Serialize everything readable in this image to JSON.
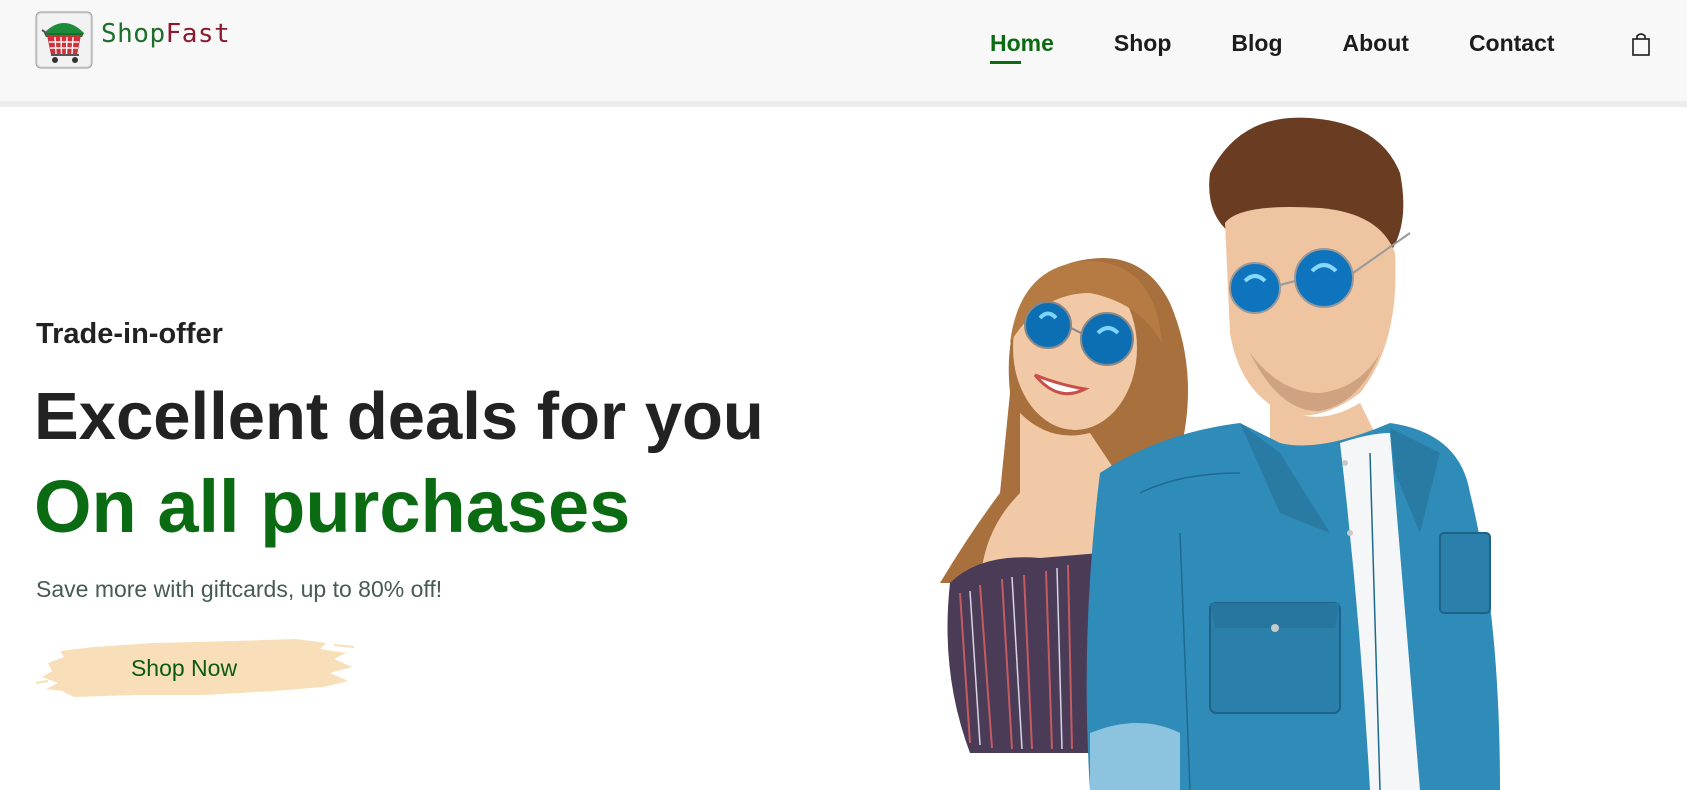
{
  "brand": {
    "part1": "Shop",
    "part2": "Fast"
  },
  "nav": {
    "items": [
      {
        "label": "Home",
        "active": true
      },
      {
        "label": "Shop",
        "active": false
      },
      {
        "label": "Blog",
        "active": false
      },
      {
        "label": "About",
        "active": false
      },
      {
        "label": "Contact",
        "active": false
      }
    ],
    "cart_icon": "shopping-bag-icon"
  },
  "hero": {
    "eyebrow": "Trade-in-offer",
    "headline": "Excellent deals for you",
    "headline_accent": "On all purchases",
    "subtext": "Save more with giftcards, up to 80% off!",
    "cta_label": "Shop Now",
    "image": "couple-in-sunglasses"
  },
  "colors": {
    "accent": "#0b6b12",
    "brand_shop": "#1d6f2a",
    "brand_fast": "#8b1a2f",
    "header_bg": "#f8f8f8",
    "cta_bg": "#f9dfb9"
  }
}
